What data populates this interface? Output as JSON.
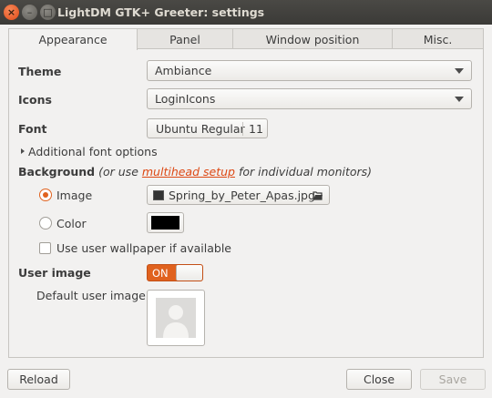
{
  "window": {
    "title": "LightDM GTK+ Greeter: settings",
    "close_glyph": "×",
    "minimize_glyph": "–",
    "maximize_glyph": "□"
  },
  "tabs": [
    {
      "label": "Appearance",
      "active": true
    },
    {
      "label": "Panel",
      "active": false
    },
    {
      "label": "Window position",
      "active": false
    },
    {
      "label": "Misc.",
      "active": false
    }
  ],
  "appearance": {
    "theme_label": "Theme",
    "theme_value": "Ambiance",
    "icons_label": "Icons",
    "icons_value": "LoginIcons",
    "font_label": "Font",
    "font_name": "Ubuntu Regular",
    "font_size": "11",
    "additional_font_options": "Additional font options",
    "background_label": "Background",
    "background_note_prefix": "(or use",
    "background_note_link": "multihead setup",
    "background_note_suffix": "for individual monitors)",
    "image_option": "Image",
    "image_selected": true,
    "image_file": "Spring_by_Peter_Apas.jpg",
    "color_option": "Color",
    "color_value": "#000000",
    "use_user_wallpaper": "Use user wallpaper if available",
    "use_user_wallpaper_checked": false,
    "user_image_label": "User image",
    "user_image_toggle": "ON",
    "user_image_on": true,
    "default_user_image_label": "Default user image"
  },
  "buttons": {
    "reload": "Reload",
    "close": "Close",
    "save": "Save"
  },
  "colors": {
    "accent": "#e0621e",
    "link": "#dd4814",
    "titlebar": "#3c3b37"
  },
  "icons": {
    "file_type": "image-file-icon",
    "open_file": "folder-open-icon",
    "avatar": "default-avatar-icon"
  }
}
